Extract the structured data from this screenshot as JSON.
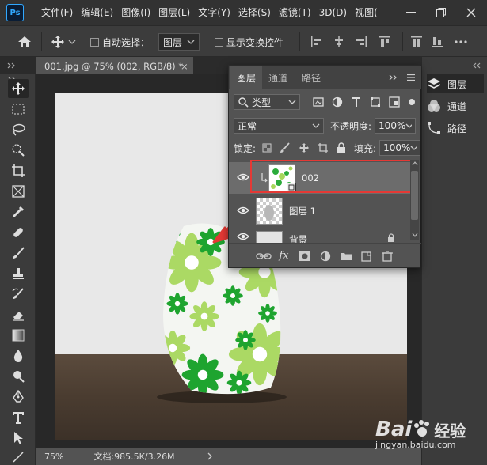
{
  "app": {
    "logo": "Ps",
    "menus": [
      "文件(F)",
      "编辑(E)",
      "图像(I)",
      "图层(L)",
      "文字(Y)",
      "选择(S)",
      "滤镜(T)",
      "3D(D)",
      "视图("
    ]
  },
  "options": {
    "auto_select_label": "自动选择：",
    "auto_select_value": "图层",
    "show_transform_label": "显示变换控件"
  },
  "document": {
    "tab_title": "001.jpg @ 75% (002, RGB/8) *",
    "tab_close": "×"
  },
  "status": {
    "zoom": "75%",
    "doc_info": "文档:985.5K/3.26M"
  },
  "layers_panel": {
    "tabs": [
      "图层",
      "通道",
      "路径"
    ],
    "filter_label": "类型",
    "blend_mode": "正常",
    "opacity_label": "不透明度:",
    "opacity_value": "100%",
    "lock_label": "锁定:",
    "fill_label": "填充:",
    "fill_value": "100%",
    "layers": [
      {
        "name": "002"
      },
      {
        "name": "图层 1"
      },
      {
        "name": "背景"
      }
    ]
  },
  "right_panel": {
    "items": [
      "图层",
      "通道",
      "路径"
    ]
  },
  "watermark": {
    "brand": "Bai",
    "brand_suffix": "经验",
    "url": "jingyan.baidu.com"
  },
  "colors": {
    "accent_red": "#e53935",
    "flower_dark": "#1e9e2e",
    "flower_light": "#9ed85a"
  }
}
